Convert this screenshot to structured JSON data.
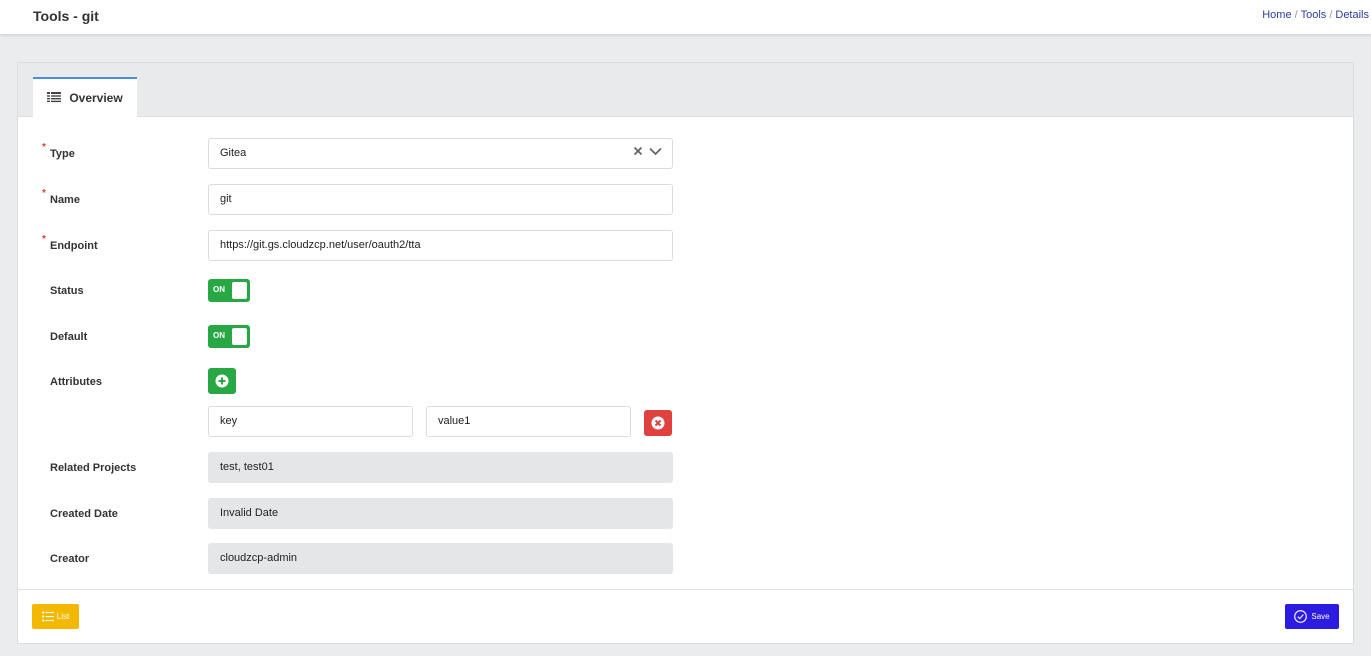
{
  "header": {
    "title": "Tools - git",
    "breadcrumb": [
      "Home",
      "Tools",
      "Details"
    ]
  },
  "tabs": [
    {
      "label": "Overview",
      "icon": "list-icon"
    }
  ],
  "form": {
    "type": {
      "label": "Type",
      "value": "Gitea",
      "required": true
    },
    "name": {
      "label": "Name",
      "value": "git",
      "required": true
    },
    "endpoint": {
      "label": "Endpoint",
      "value": "https://git.gs.cloudzcp.net/user/oauth2/tta",
      "required": true
    },
    "status": {
      "label": "Status",
      "value": "ON"
    },
    "default": {
      "label": "Default",
      "value": "ON"
    },
    "attributes": {
      "label": "Attributes",
      "items": [
        {
          "key": "key",
          "value": "value1"
        }
      ]
    },
    "related_projects": {
      "label": "Related Projects",
      "value": "test, test01"
    },
    "created_date": {
      "label": "Created Date",
      "value": "Invalid Date"
    },
    "creator": {
      "label": "Creator",
      "value": "cloudzcp-admin"
    }
  },
  "footer": {
    "list_label": "List",
    "save_label": "Save"
  },
  "colors": {
    "accent_green": "#28a745",
    "danger_red": "#e0403e",
    "list_yellow": "#f5b800",
    "save_blue": "#2c1be0"
  }
}
